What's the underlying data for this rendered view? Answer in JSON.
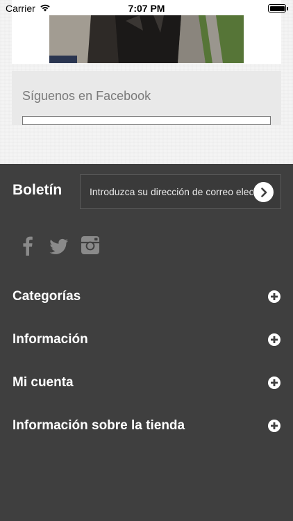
{
  "status_bar": {
    "carrier": "Carrier",
    "time": "7:07 PM",
    "icons": [
      "wifi-icon",
      "battery-icon"
    ]
  },
  "facebook_widget": {
    "title": "Síguenos en Facebook"
  },
  "newsletter": {
    "title": "Boletín",
    "placeholder": "Introduzca su dirección de correo electrónico",
    "submit_icon": "chevron-right-icon"
  },
  "social": {
    "icons": [
      "facebook-icon",
      "twitter-icon",
      "instagram-icon"
    ]
  },
  "accordion": {
    "items": [
      {
        "label": "Categorías"
      },
      {
        "label": "Información"
      },
      {
        "label": "Mi cuenta"
      },
      {
        "label": "Información sobre la tienda"
      }
    ],
    "expand_icon": "plus-circle-icon"
  },
  "colors": {
    "footer_bg": "#3f3f3f",
    "social_icon": "#8a8a8a",
    "text_light": "#ffffff"
  }
}
